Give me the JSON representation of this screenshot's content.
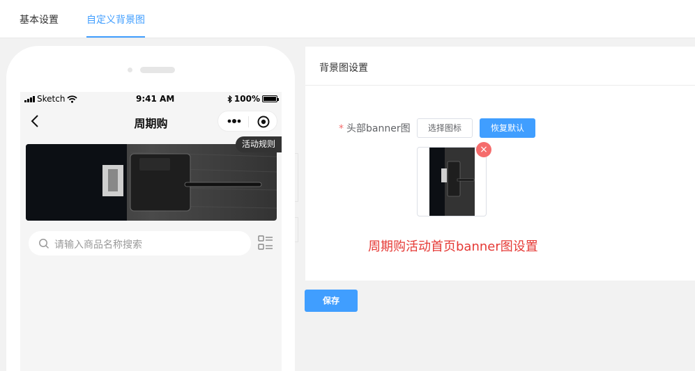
{
  "tabs": [
    {
      "label": "基本设置"
    },
    {
      "label": "自定义背景图"
    }
  ],
  "phone": {
    "status": {
      "carrier": "Sketch",
      "time": "9:41 AM",
      "battery": "100%"
    },
    "nav_title": "周期购",
    "rules_label": "活动规则",
    "search_placeholder": "请输入商品名称搜索"
  },
  "card": {
    "title": "背景图设置",
    "field_required_mark": "*",
    "field_label": "头部banner图",
    "select_button": "选择图标",
    "restore_button": "恢复默认",
    "remove_symbol": "×",
    "note": "周期购活动首页banner图设置"
  },
  "save_button": "保存",
  "colors": {
    "primary": "#409eff",
    "danger": "#f56c6c",
    "note_red": "#e53935"
  }
}
